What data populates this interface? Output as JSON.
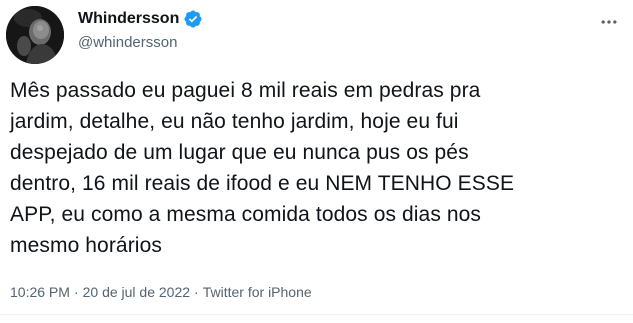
{
  "author": {
    "display_name": "Whindersson",
    "handle": "@whindersson",
    "verified": true,
    "avatar_icon": "profile-avatar"
  },
  "tweet": {
    "text": "Mês passado eu paguei 8 mil reais em pedras pra\njardim, detalhe, eu não tenho jardim, hoje eu fui\ndespejado de um lugar que eu nunca pus os pés\ndentro, 16 mil reais de ifood e eu NEM TENHO ESSE\nAPP, eu como a mesma comida todos os dias nos\nmesmo horários"
  },
  "meta": {
    "time": "10:26 PM",
    "separator": "·",
    "date": "20 de jul de 2022",
    "source": "Twitter for iPhone"
  },
  "icons": {
    "more": "more-dots-icon",
    "verified": "verified-badge-icon"
  },
  "colors": {
    "verified_blue": "#1d9bf0",
    "text_primary": "#0f1419",
    "text_secondary": "#536471"
  }
}
